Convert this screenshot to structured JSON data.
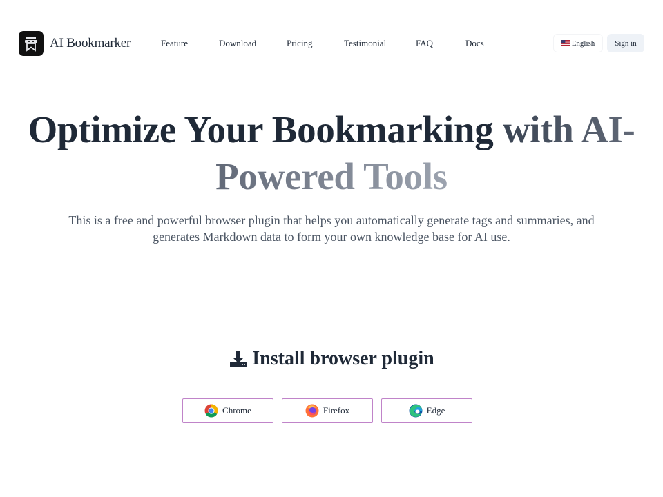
{
  "brand": {
    "name": "AI Bookmarker",
    "logo_icon": "bookmark-robot-icon",
    "logo_bg": "#111111"
  },
  "nav": {
    "items": [
      "Feature",
      "Download",
      "Pricing",
      "Testimonial",
      "FAQ",
      "Docs"
    ]
  },
  "header": {
    "language_label": "English",
    "language_flag_icon": "us-flag-icon",
    "signin_label": "Sign in"
  },
  "hero": {
    "title_part1": "Optimize Your Bookmarking ",
    "title_part2": "with AI-Powered Tools",
    "subtitle": "This is a free and powerful browser plugin that helps you automatically generate tags and summaries, and generates Markdown data to form your own knowledge base for AI use."
  },
  "install": {
    "icon": "download-icon",
    "title": "Install browser plugin",
    "buttons": [
      {
        "label": "Chrome",
        "icon": "chrome-icon"
      },
      {
        "label": "Firefox",
        "icon": "firefox-icon"
      },
      {
        "label": "Edge",
        "icon": "edge-icon"
      }
    ],
    "button_border_color": "#c084c9"
  },
  "colors": {
    "text": "#1f2937",
    "subtext": "#4b5563",
    "signin_bg": "#eef2f7"
  }
}
